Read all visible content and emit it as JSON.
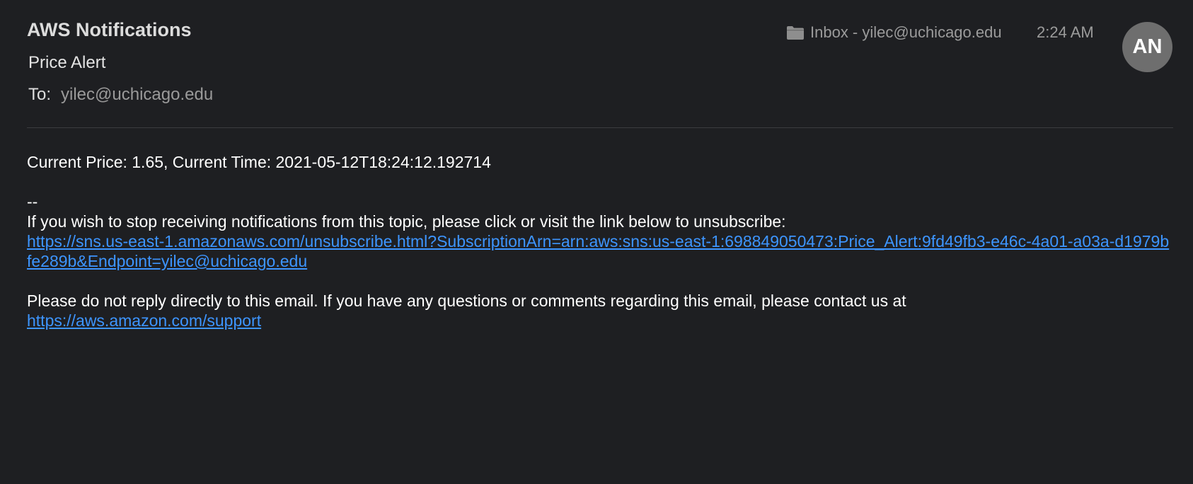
{
  "header": {
    "sender": "AWS Notifications",
    "subject": "Price Alert",
    "to_label": "To:",
    "to_value": "yilec@uchicago.edu",
    "mailbox": "Inbox - yilec@uchicago.edu",
    "time": "2:24 AM",
    "avatar_initials": "AN",
    "icon": "folder-icon"
  },
  "body": {
    "current_line": "Current Price: 1.65, Current Time: 2021-05-12T18:24:12.192714",
    "separator": "--",
    "unsubscribe_text": "If you wish to stop receiving notifications from this topic, please click or visit the link below to unsubscribe:",
    "unsubscribe_link": "https://sns.us-east-1.amazonaws.com/unsubscribe.html?SubscriptionArn=arn:aws:sns:us-east-1:698849050473:Price_Alert:9fd49fb3-e46c-4a01-a03a-d1979bfe289b&Endpoint=yilec@uchicago.edu",
    "noreply_text": "Please do not reply directly to this email. If you have any questions or comments regarding this email, please contact us at",
    "support_link": "https://aws.amazon.com/support"
  },
  "colors": {
    "background": "#1e1f22",
    "link": "#3d95ff",
    "avatar": "#6e6e6e"
  }
}
